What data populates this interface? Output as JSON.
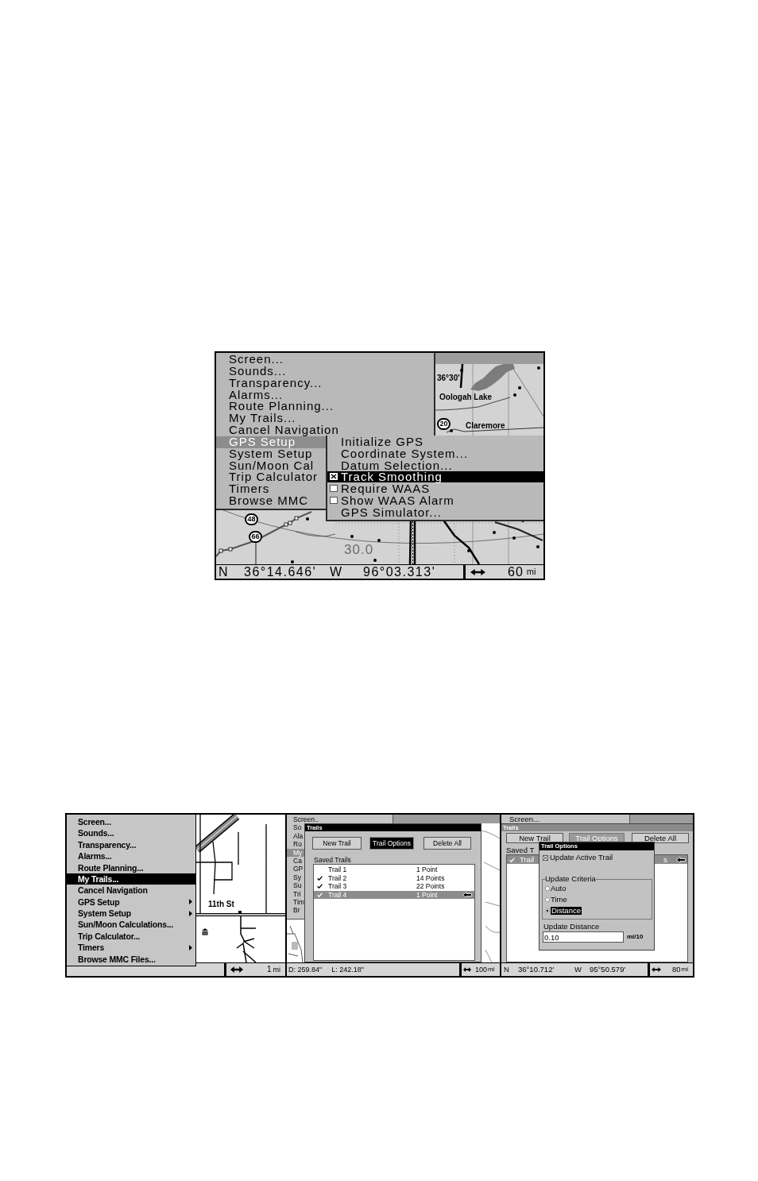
{
  "top_screen": {
    "menu": [
      {
        "label": "Screen...",
        "selected": false
      },
      {
        "label": "Sounds...",
        "selected": false
      },
      {
        "label": "Transparency...",
        "selected": false
      },
      {
        "label": "Alarms...",
        "selected": false
      },
      {
        "label": "Route Planning...",
        "selected": false
      },
      {
        "label": "My Trails...",
        "selected": false
      },
      {
        "label": "Cancel Navigation",
        "selected": false
      },
      {
        "label": "GPS Setup",
        "selected": true
      },
      {
        "label": "System Setup",
        "selected": false
      },
      {
        "label": "Sun/Moon Cal",
        "selected": false
      },
      {
        "label": "Trip Calculator",
        "selected": false
      },
      {
        "label": "Timers",
        "selected": false
      },
      {
        "label": "Browse MMC",
        "selected": false
      }
    ],
    "submenu": [
      {
        "label": "Initialize GPS",
        "kind": "command",
        "selected": false
      },
      {
        "label": "Coordinate System...",
        "kind": "command",
        "selected": false
      },
      {
        "label": "Datum Selection...",
        "kind": "command",
        "selected": false
      },
      {
        "label": "Track Smoothing",
        "kind": "checkbox",
        "checked": true,
        "selected": true
      },
      {
        "label": "Require WAAS",
        "kind": "checkbox",
        "checked": false,
        "selected": false
      },
      {
        "label": "Show WAAS Alarm",
        "kind": "checkbox",
        "checked": false,
        "selected": false
      },
      {
        "label": "GPS Simulator...",
        "kind": "command",
        "selected": false
      }
    ],
    "map_labels": [
      {
        "text": "36°30'",
        "kind": "place"
      },
      {
        "text": "Oologah Lake",
        "kind": "place"
      },
      {
        "text": "20",
        "kind": "route"
      },
      {
        "text": "Claremore",
        "kind": "place"
      },
      {
        "text": "48",
        "kind": "route"
      },
      {
        "text": "66",
        "kind": "route"
      },
      {
        "text": "30.0",
        "kind": "range"
      }
    ],
    "status_bar": {
      "latitude_hemisphere": "N",
      "latitude": "36°14.646'",
      "longitude_hemisphere": "W",
      "longitude": "96°03.313'",
      "scale": "60",
      "scale_unit": "mi"
    }
  },
  "menu_screen": {
    "menu": [
      {
        "label": "Screen...",
        "selected": false,
        "has_submenu": false
      },
      {
        "label": "Sounds...",
        "selected": false,
        "has_submenu": false
      },
      {
        "label": "Transparency...",
        "selected": false,
        "has_submenu": false
      },
      {
        "label": "Alarms...",
        "selected": false,
        "has_submenu": false
      },
      {
        "label": "Route Planning...",
        "selected": false,
        "has_submenu": false
      },
      {
        "label": "My Trails...",
        "selected": true,
        "has_submenu": false
      },
      {
        "label": "Cancel Navigation",
        "selected": false,
        "has_submenu": false
      },
      {
        "label": "GPS Setup",
        "selected": false,
        "has_submenu": true
      },
      {
        "label": "System Setup",
        "selected": false,
        "has_submenu": true
      },
      {
        "label": "Sun/Moon Calculations...",
        "selected": false,
        "has_submenu": false
      },
      {
        "label": "Trip Calculator...",
        "selected": false,
        "has_submenu": false
      },
      {
        "label": "Timers",
        "selected": false,
        "has_submenu": true
      },
      {
        "label": "Browse MMC Files...",
        "selected": false,
        "has_submenu": false
      }
    ],
    "map_labels": [
      {
        "text": "11th St"
      }
    ],
    "status_bar": {
      "scale": "1",
      "scale_unit": "mi"
    }
  },
  "trails_screen": {
    "menu": [
      {
        "label": "Screen..",
        "selected": false
      },
      {
        "label": "So",
        "selected": false
      },
      {
        "label": "Ala",
        "selected": false
      },
      {
        "label": "Ro",
        "selected": false
      },
      {
        "label": "My",
        "selected": true
      },
      {
        "label": "Ca",
        "selected": false
      },
      {
        "label": "GP",
        "selected": false
      },
      {
        "label": "Sy",
        "selected": false
      },
      {
        "label": "Su",
        "selected": false
      },
      {
        "label": "Tri",
        "selected": false
      },
      {
        "label": "Tim",
        "selected": false
      },
      {
        "label": "Br",
        "selected": false
      }
    ],
    "dialog": {
      "title": "Trails",
      "buttons": [
        {
          "label": "New Trail",
          "selected": false
        },
        {
          "label": "Trail Options",
          "selected": true
        },
        {
          "label": "Delete All",
          "selected": false
        }
      ],
      "list_label": "Saved Trails",
      "trails": [
        {
          "name": "Trail 1",
          "points": "1 Point",
          "checked": false,
          "selected": false,
          "active": false
        },
        {
          "name": "Trail 2",
          "points": "14 Points",
          "checked": true,
          "selected": false,
          "active": false
        },
        {
          "name": "Trail 3",
          "points": "22 Points",
          "checked": true,
          "selected": false,
          "active": false
        },
        {
          "name": "Trail 4",
          "points": "1 Point",
          "checked": true,
          "selected": true,
          "active": true
        }
      ]
    },
    "status_bar": {
      "distance": "D: 259.84\"",
      "length": "L: 242.18\"",
      "scale": "100",
      "scale_unit": "mi"
    }
  },
  "trail_options_screen": {
    "menu": [
      {
        "label": "Screen...",
        "selected": false
      }
    ],
    "dialog": {
      "title": "Trails",
      "buttons": [
        {
          "label": "New Trail",
          "selected": false
        },
        {
          "label": "Trail Options",
          "selected": true
        },
        {
          "label": "Delete All",
          "selected": false
        }
      ],
      "list_label": "Saved T",
      "trails": [
        {
          "name": "Trail",
          "points": "s",
          "checked": true,
          "selected": true,
          "active": true
        }
      ]
    },
    "options_dialog": {
      "title": "Trail Options",
      "update_active_trail": {
        "label": "Update Active Trail",
        "checked": true
      },
      "criteria_label": "Update Criteria",
      "criteria": [
        {
          "label": "Auto",
          "selected": false
        },
        {
          "label": "Time",
          "selected": false
        },
        {
          "label": "Distance",
          "selected": true
        }
      ],
      "distance_label": "Update Distance",
      "distance_value": "0.10",
      "distance_unit": "mi/10"
    },
    "status_bar": {
      "latitude_hemisphere": "N",
      "latitude": "36°10.712'",
      "longitude_hemisphere": "W",
      "longitude": "95°50.579'",
      "scale": "80",
      "scale_unit": "mi"
    }
  }
}
